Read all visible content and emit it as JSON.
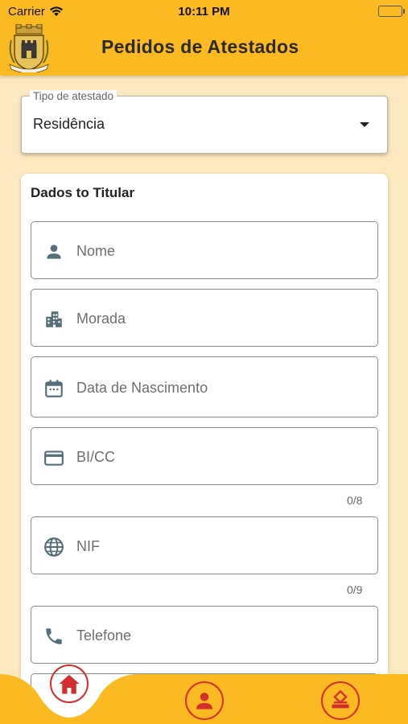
{
  "status_bar": {
    "carrier": "Carrier",
    "time": "10:11 PM"
  },
  "header": {
    "title": "Pedidos de Atestados"
  },
  "certificate_type": {
    "label": "Tipo de atestado",
    "value": "Residência"
  },
  "holder_form": {
    "title": "Dados to Titular",
    "fields": {
      "nome": {
        "placeholder": "Nome",
        "icon": "person-icon"
      },
      "morada": {
        "placeholder": "Morada",
        "icon": "city-icon"
      },
      "nascimento": {
        "placeholder": "Data de Nascimento",
        "icon": "calendar-icon"
      },
      "bicc": {
        "placeholder": "BI/CC",
        "icon": "id-card-icon",
        "counter": "0/8"
      },
      "nif": {
        "placeholder": "NIF",
        "icon": "globe-icon",
        "counter": "0/9"
      },
      "telefone": {
        "placeholder": "Telefone",
        "icon": "phone-icon"
      }
    }
  },
  "bottom_nav": {
    "items": [
      "home",
      "profile",
      "requests"
    ]
  },
  "colors": {
    "accent": "#fbb922",
    "background": "#fde9bf",
    "nav_icon": "#d32f2f",
    "input_icon": "#546e7a"
  }
}
